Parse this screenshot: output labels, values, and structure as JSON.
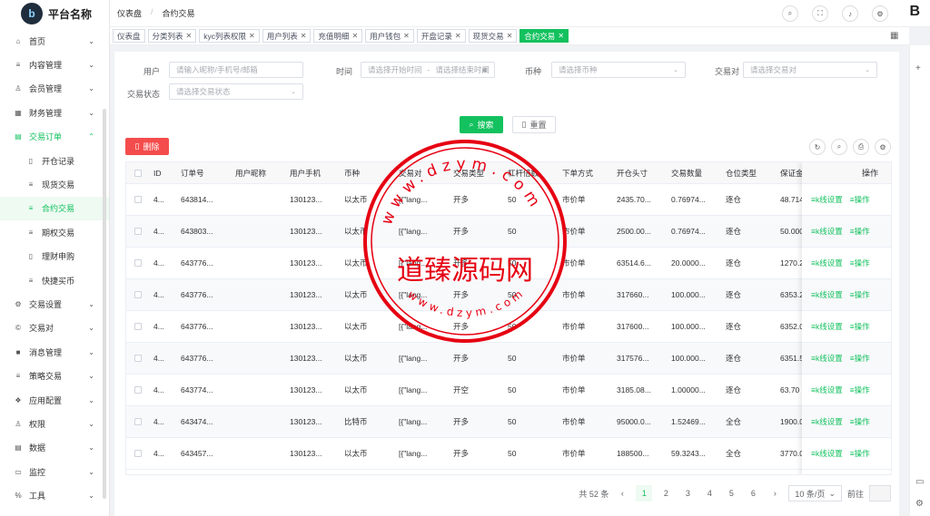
{
  "app": {
    "title": "平台名称",
    "brand_mark": "B"
  },
  "breadcrumb": [
    "仪表盘",
    "合约交易"
  ],
  "sidebar": [
    {
      "label": "首页",
      "icon": "home-icon",
      "chevron": "⌄"
    },
    {
      "label": "内容管理",
      "icon": "list-icon",
      "chevron": "⌄"
    },
    {
      "label": "会员管理",
      "icon": "user-icon",
      "chevron": "⌄"
    },
    {
      "label": "财务管理",
      "icon": "finance-icon",
      "chevron": "⌄"
    },
    {
      "label": "交易订单",
      "icon": "order-icon",
      "chevron": "⌃"
    },
    {
      "label": "开仓记录",
      "icon": "record-icon"
    },
    {
      "label": "现货交易",
      "icon": "list-icon"
    },
    {
      "label": "合约交易",
      "icon": "list-icon"
    },
    {
      "label": "期权交易",
      "icon": "list-icon"
    },
    {
      "label": "理财申购",
      "icon": "record-icon"
    },
    {
      "label": "快捷买币",
      "icon": "list-icon"
    },
    {
      "label": "交易设置",
      "icon": "settings-icon",
      "chevron": "⌄"
    },
    {
      "label": "交易对",
      "icon": "coin-icon",
      "chevron": "⌄"
    },
    {
      "label": "消息管理",
      "icon": "message-icon",
      "chevron": "⌄"
    },
    {
      "label": "策略交易",
      "icon": "list-icon",
      "chevron": "⌄"
    },
    {
      "label": "应用配置",
      "icon": "app-icon",
      "chevron": "⌄"
    },
    {
      "label": "权限",
      "icon": "permission-icon",
      "chevron": "⌄"
    },
    {
      "label": "数据",
      "icon": "data-icon",
      "chevron": "⌄"
    },
    {
      "label": "监控",
      "icon": "monitor-icon",
      "chevron": "⌄"
    },
    {
      "label": "工具",
      "icon": "tool-icon",
      "chevron": "⌄"
    }
  ],
  "tags": [
    "仪表盘",
    "分类列表",
    "kyc列表权限",
    "用户列表",
    "充值明细",
    "用户钱包",
    "开盘记录",
    "现货交易",
    "合约交易"
  ],
  "filters": {
    "user_label": "用户",
    "user_placeholder": "请输入昵称/手机号/邮箱",
    "time_label": "时间",
    "time_start": "请选择开始时间",
    "time_sep": "-",
    "time_end": "请选择结束时间",
    "coin_label": "币种",
    "coin_placeholder": "请选择币种",
    "pair_label": "交易对",
    "pair_placeholder": "请选择交易对",
    "status_label": "交易状态",
    "status_placeholder": "请选择交易状态"
  },
  "buttons": {
    "search": "搜索",
    "reset": "重置",
    "delete": "删除"
  },
  "table": {
    "headers": [
      "ID",
      "订单号",
      "用户昵称",
      "用户手机",
      "币种",
      "交易对",
      "交易类型",
      "杠杆倍数",
      "下单方式",
      "开仓头寸",
      "交易数量",
      "仓位类型",
      "保证金"
    ],
    "op_header": "操作",
    "rows": [
      [
        "4...",
        "643814...",
        "",
        "130123...",
        "以太币",
        "[{\"lang...",
        "开多",
        "50",
        "市价单",
        "2435.70...",
        "0.76974...",
        "逐仓",
        "48.714"
      ],
      [
        "4...",
        "643803...",
        "",
        "130123...",
        "以太币",
        "[{\"lang...",
        "开多",
        "50",
        "市价单",
        "2500.00...",
        "0.76974...",
        "逐仓",
        "50.000"
      ],
      [
        "4...",
        "643776...",
        "",
        "130123...",
        "以太币",
        "[{\"lang...",
        "开多",
        "50",
        "市价单",
        "63514.6...",
        "20.0000...",
        "逐仓",
        "1270.2"
      ],
      [
        "4...",
        "643776...",
        "",
        "130123...",
        "以太币",
        "[{\"lang...",
        "开多",
        "50",
        "市价单",
        "317660...",
        "100.000...",
        "逐仓",
        "6353.2"
      ],
      [
        "4...",
        "643776...",
        "",
        "130123...",
        "以太币",
        "[{\"lang...",
        "开多",
        "50",
        "市价单",
        "317600...",
        "100.000...",
        "逐仓",
        "6352.0"
      ],
      [
        "4...",
        "643776...",
        "",
        "130123...",
        "以太币",
        "[{\"lang...",
        "开多",
        "50",
        "市价单",
        "317576...",
        "100.000...",
        "逐仓",
        "6351.5"
      ],
      [
        "4...",
        "643774...",
        "",
        "130123...",
        "以太币",
        "[{\"lang...",
        "开空",
        "50",
        "市价单",
        "3185.08...",
        "1.00000...",
        "逐仓",
        "63.70"
      ],
      [
        "4...",
        "643474...",
        "",
        "130123...",
        "比特币",
        "[{\"lang...",
        "开多",
        "50",
        "市价单",
        "95000.0...",
        "1.52469...",
        "全仓",
        "1900.0"
      ],
      [
        "4...",
        "643457...",
        "",
        "130123...",
        "以太币",
        "[{\"lang...",
        "开多",
        "50",
        "市价单",
        "188500...",
        "59.3243...",
        "全仓",
        "3770.0"
      ]
    ],
    "op_links": [
      "≡k线设置",
      "≡操作"
    ]
  },
  "pagination": {
    "total": "共 52 条",
    "pages": [
      "1",
      "2",
      "3",
      "4",
      "5",
      "6"
    ],
    "current": "1",
    "size": "10 条/页",
    "goto": "前往",
    "prev": "‹",
    "next": "›"
  },
  "watermark": {
    "text": "道臻源码网",
    "ring": "www.dzym.com"
  }
}
